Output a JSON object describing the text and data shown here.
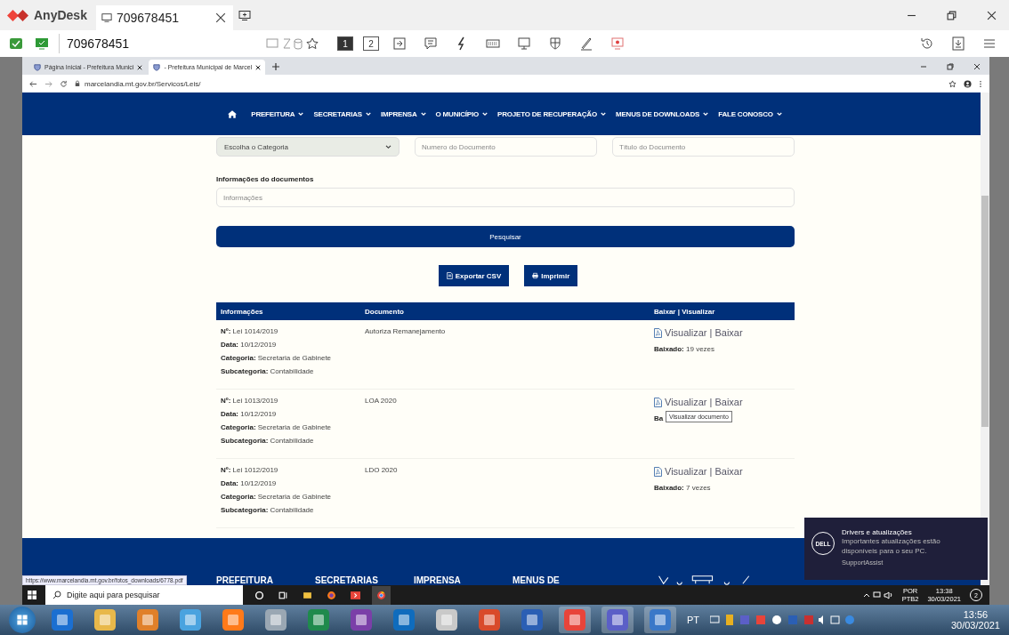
{
  "anydesk": {
    "app_name": "AnyDesk",
    "tab_title": "709678451",
    "address": "709678451",
    "monitors": [
      {
        "label": "1",
        "selected": true
      },
      {
        "label": "2",
        "selected": false
      }
    ]
  },
  "browser": {
    "tabs": [
      {
        "title": "Página Inicial - Prefeitura Munici",
        "selected": false
      },
      {
        "title": "- Prefeitura Municipal de Marcel",
        "selected": true
      }
    ],
    "url": "marcelandia.mt.gov.br/Servicos/Leis/"
  },
  "nav": [
    "PREFEITURA",
    "SECRETARIAS",
    "IMPRENSA",
    "O MUNICÍPIO",
    "PROJETO DE RECUPERAÇÃO",
    "MENUS DE DOWNLOADS",
    "FALE CONOSCO"
  ],
  "filters": {
    "category": "Escolha o Categoria",
    "number_placeholder": "Numero do Documento",
    "title_placeholder": "Título do Documento"
  },
  "info": {
    "label": "Informações do documentos",
    "placeholder": "Informações"
  },
  "search_button": "Pesquisar",
  "actions": [
    {
      "kind": "csv",
      "label": "Exportar CSV"
    },
    {
      "kind": "print",
      "label": "Imprimir"
    }
  ],
  "table": {
    "columns": [
      "Informações",
      "Documento",
      "Baixar | Visualizar"
    ],
    "rows": [
      {
        "fields": [
          {
            "label": "Nº:",
            "value": "Lei 1014/2019"
          },
          {
            "label": "Data:",
            "value": "10/12/2019"
          },
          {
            "label": "Categoria:",
            "value": "Secretaria de Gabinete"
          },
          {
            "label": "Subcategoria:",
            "value": "Contabilidade"
          }
        ],
        "document": "Autoriza Remanejamento",
        "link": "Visualizar | Baixar",
        "downloads": {
          "label": "Baixado:",
          "value": "19 vezes"
        }
      },
      {
        "fields": [
          {
            "label": "Nº:",
            "value": "Lei 1013/2019"
          },
          {
            "label": "Data:",
            "value": "10/12/2019"
          },
          {
            "label": "Categoria:",
            "value": "Secretaria de Gabinete"
          },
          {
            "label": "Subcategoria:",
            "value": "Contabilidade"
          }
        ],
        "document": "LOA 2020",
        "link": "Visualizar | Baixar",
        "downloads": {
          "label": "Ba"
        },
        "tooltip": "Visualizar documento"
      },
      {
        "fields": [
          {
            "label": "Nº:",
            "value": "Lei 1012/2019"
          },
          {
            "label": "Data:",
            "value": "10/12/2019"
          },
          {
            "label": "Categoria:",
            "value": "Secretaria de Gabinete"
          },
          {
            "label": "Subcategoria:",
            "value": "Contabilidade"
          }
        ],
        "document": "LDO 2020",
        "link": "Visualizar | Baixar",
        "downloads": {
          "label": "Baixado:",
          "value": "7 vezes"
        }
      }
    ]
  },
  "footer": [
    "PREFEITURA",
    "SECRETARIAS",
    "IMPRENSA",
    "MENUS DE"
  ],
  "status_url": "https://www.marcelandia.mt.gov.br/fotos_downloads/6778.pdf",
  "notification": {
    "logo": "DELL",
    "title": "Drivers e atualizações",
    "body": "Importantes atualizações estão disponíveis para o seu PC.",
    "source": "SupportAssist"
  },
  "remote_taskbar": {
    "search_placeholder": "Digite aqui para pesquisar",
    "language": "POR",
    "layout": "PTB2",
    "time": "13:38",
    "date": "30/03/2021",
    "notification_count": "2"
  },
  "local_taskbar": {
    "language": "PT",
    "time": "13:56",
    "date": "30/03/2021"
  }
}
